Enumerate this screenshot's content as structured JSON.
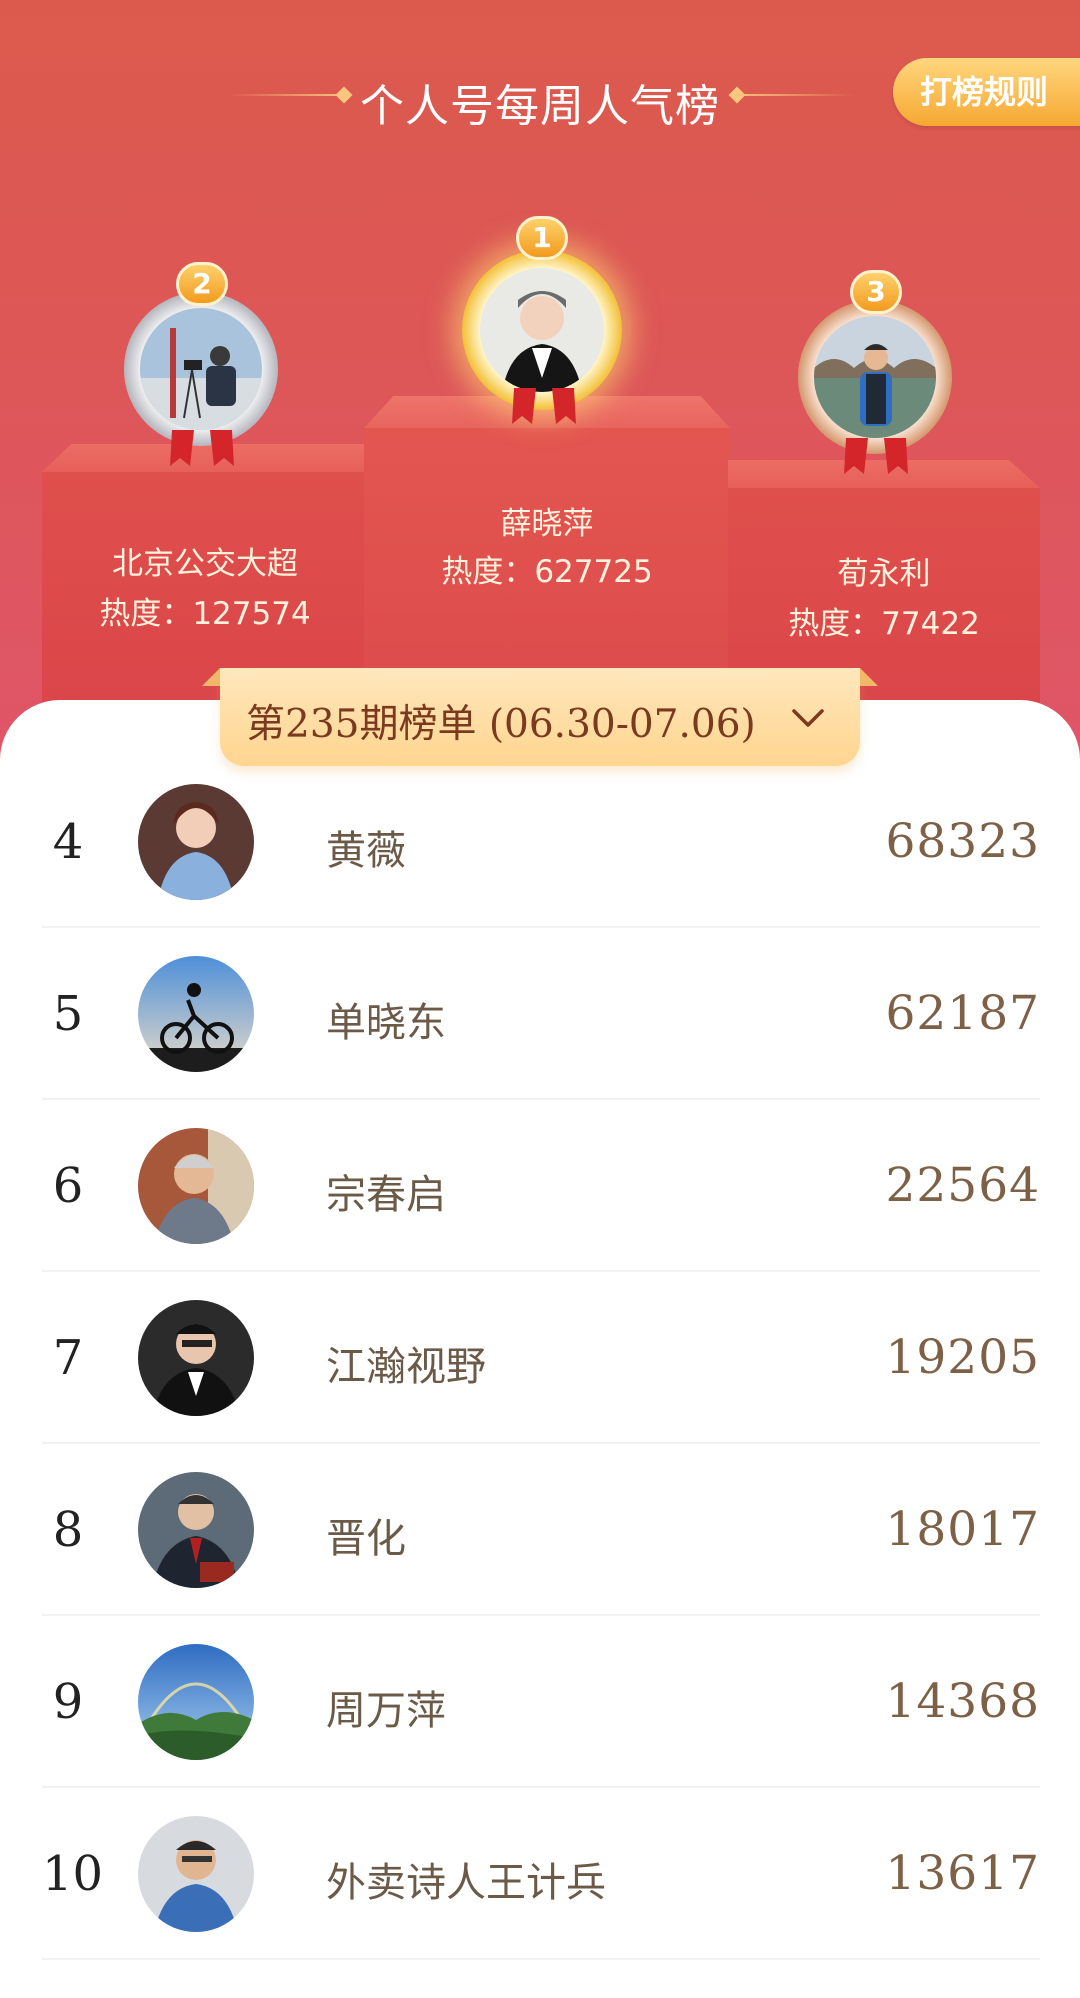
{
  "header": {
    "title": "个人号每周人气榜",
    "rules_button": "打榜规则"
  },
  "podium": [
    {
      "rank": "2",
      "name": "北京公交大超",
      "heat": "热度：127574",
      "medal": "silver"
    },
    {
      "rank": "1",
      "name": "薛晓萍",
      "heat": "热度：627725",
      "medal": "gold"
    },
    {
      "rank": "3",
      "name": "荀永利",
      "heat": "热度：77422",
      "medal": "bronze"
    }
  ],
  "period": {
    "label": "第235期榜单 (06.30-07.06)",
    "chevron_icon": "chevron-down-icon"
  },
  "list": [
    {
      "rank": "4",
      "name": "黄薇",
      "score": "68323"
    },
    {
      "rank": "5",
      "name": "单晓东",
      "score": "62187"
    },
    {
      "rank": "6",
      "name": "宗春启",
      "score": "22564"
    },
    {
      "rank": "7",
      "name": "江瀚视野",
      "score": "19205"
    },
    {
      "rank": "8",
      "name": "晋化",
      "score": "18017"
    },
    {
      "rank": "9",
      "name": "周万萍",
      "score": "14368"
    },
    {
      "rank": "10",
      "name": "外卖诗人王计兵",
      "score": "13617"
    }
  ],
  "colors": {
    "hero_red": "#dd5757",
    "gold": "#f6a832",
    "score_brown": "#7d6147"
  }
}
